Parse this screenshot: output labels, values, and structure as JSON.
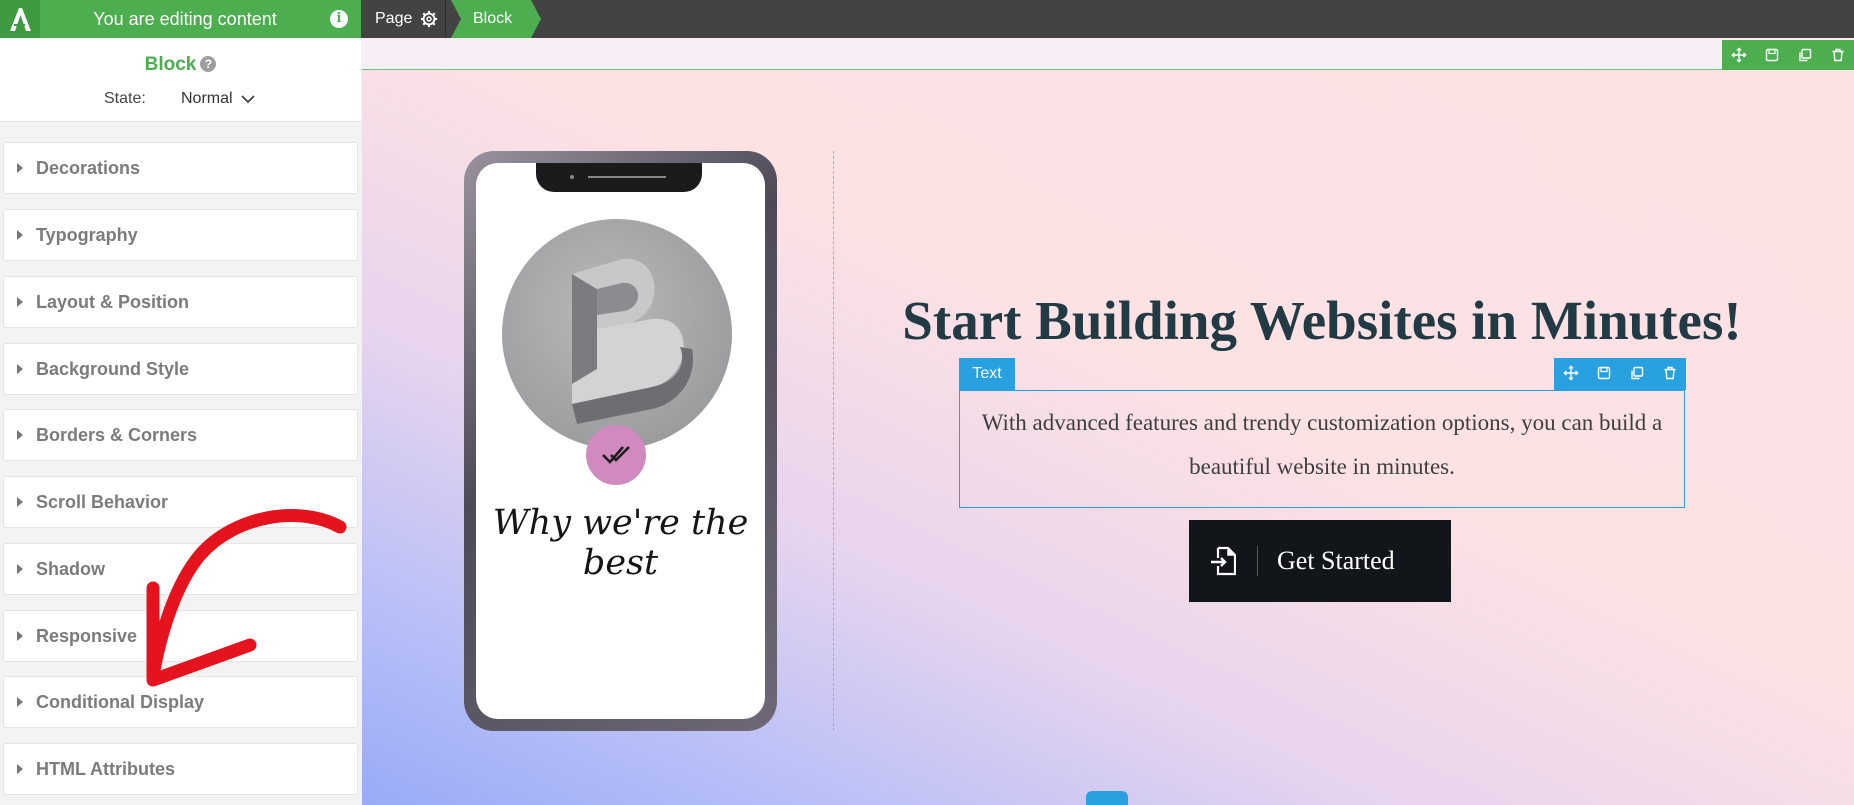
{
  "topbar": {
    "editing_title": "You are editing content",
    "crumb_page": "Page",
    "crumb_block": "Block",
    "icons": [
      "logo-icon",
      "info-icon",
      "gear-icon"
    ]
  },
  "sidebar": {
    "block_title": "Block",
    "help": "?",
    "state_label": "State:",
    "state_value": "Normal",
    "sections": [
      {
        "label": "Decorations"
      },
      {
        "label": "Typography"
      },
      {
        "label": "Layout & Position"
      },
      {
        "label": "Background Style"
      },
      {
        "label": "Borders & Corners"
      },
      {
        "label": "Scroll Behavior"
      },
      {
        "label": "Shadow"
      },
      {
        "label": "Responsive"
      },
      {
        "label": "Conditional Display"
      },
      {
        "label": "HTML Attributes"
      }
    ]
  },
  "canvas": {
    "phone_heading": "Why we're the best",
    "main_heading": "Start Building Websites in Minutes!",
    "text_tag": "Text",
    "paragraph": "With advanced features and trendy customization options, you can build a beautiful website in minutes.",
    "cta_label": "Get Started",
    "tool_icons": [
      "move-icon",
      "save-icon",
      "duplicate-icon",
      "delete-icon"
    ]
  },
  "colors": {
    "brand_green": "#4cae4f",
    "selection_blue": "#29a0e0",
    "annotation_red": "#e5131d",
    "heading_color": "#223a44"
  }
}
